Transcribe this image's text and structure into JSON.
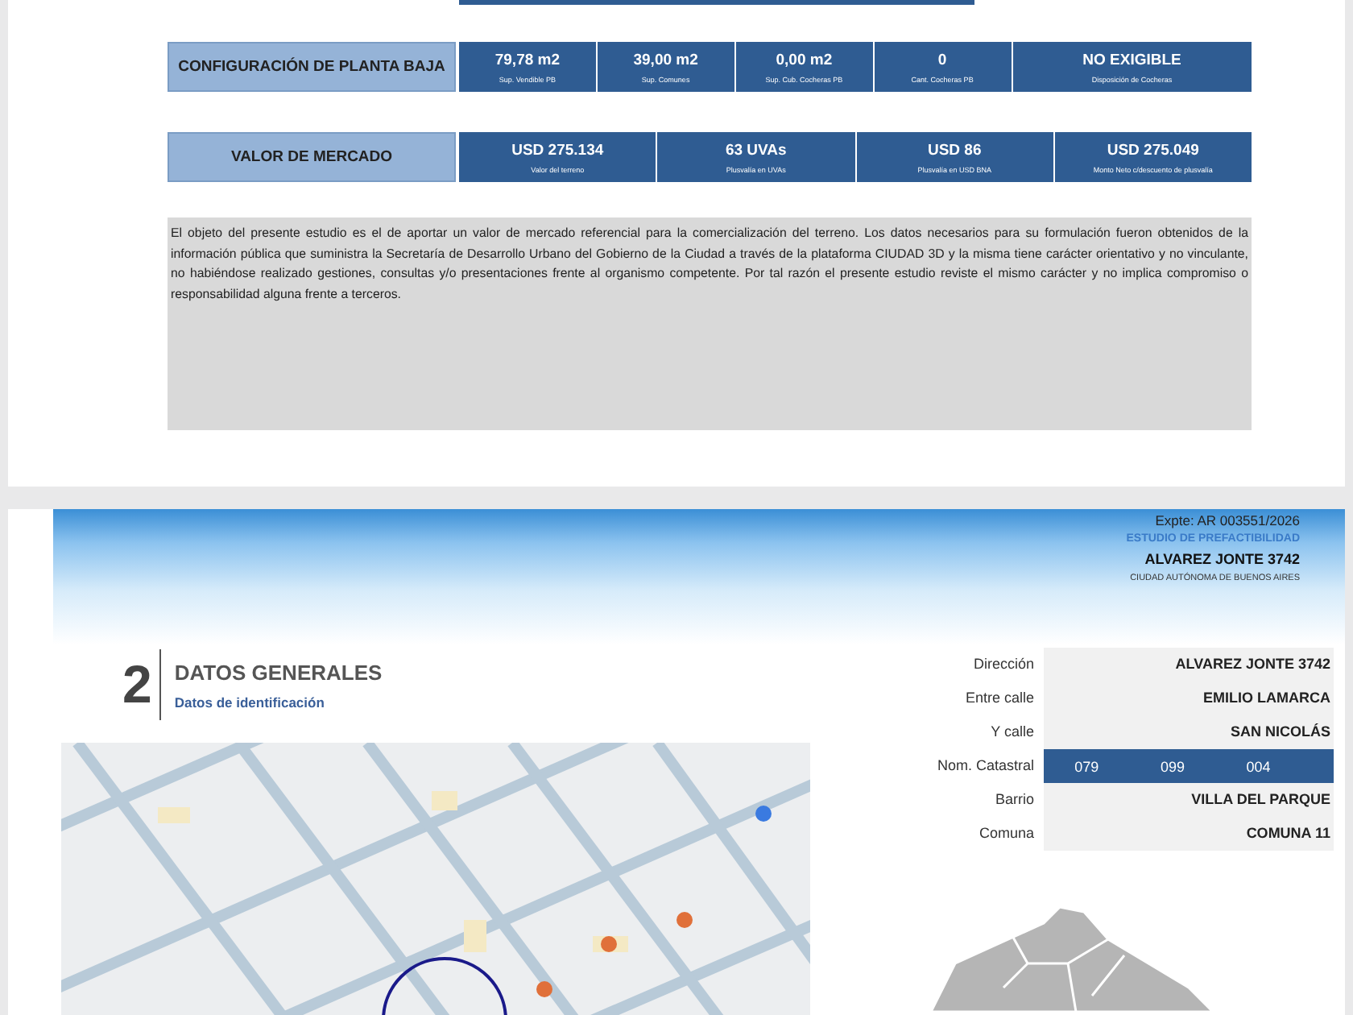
{
  "page_one": {
    "ground_floor": {
      "heading": "CONFIGURACIÓN DE PLANTA BAJA",
      "cells": [
        {
          "value": "79,78 m2",
          "caption": "Sup. Vendible PB",
          "wide": false
        },
        {
          "value": "39,00 m2",
          "caption": "Sup. Comunes",
          "wide": false
        },
        {
          "value": "0,00 m2",
          "caption": "Sup. Cub. Cocheras  PB",
          "wide": false
        },
        {
          "value": "0",
          "caption": "Cant. Cocheras PB",
          "wide": false
        },
        {
          "value": "NO EXIGIBLE",
          "caption": "Disposición de Cocheras",
          "wide": true
        }
      ]
    },
    "market_value": {
      "heading": "VALOR DE MERCADO",
      "cells": [
        {
          "value": "USD 275.134",
          "caption": "Valor del terreno"
        },
        {
          "value": "63 UVAs",
          "caption": "Plusvalía en UVAs"
        },
        {
          "value": "USD 86",
          "caption": "Plusvalía en USD  BNA"
        },
        {
          "value": "USD 275.049",
          "caption": "Monto Neto  c/descuento de plusvalía"
        }
      ]
    },
    "disclaimer": "El objeto del presente estudio es el de aportar un valor de mercado referencial para la comercialización del terreno. Los datos necesarios para su formulación fueron obtenidos de la información pública que suministra la Secretaría de Desarrollo Urbano del Gobierno de la Ciudad a través de la plataforma CIUDAD 3D y la misma tiene carácter orientativo y no vinculante, no habiéndose realizado gestiones, consultas y/o presentaciones frente al organismo competente. Por tal razón el presente estudio reviste el mismo carácter y no implica compromiso o responsabilidad alguna frente a terceros."
  },
  "page_two": {
    "header": {
      "file_number": "Expte: AR 003551/2026",
      "study_type": "ESTUDIO DE PREFACTIBILIDAD",
      "address": "ALVAREZ JONTE 3742",
      "city": "CIUDAD AUTÓNOMA DE BUENOS AIRES"
    },
    "section": {
      "number": "2",
      "title": "DATOS GENERALES",
      "subtitle": "Datos de identificación"
    },
    "details": [
      {
        "kind": "text",
        "label": "Dirección",
        "value": "ALVAREZ JONTE 3742"
      },
      {
        "kind": "text",
        "label": "Entre calle",
        "value": "EMILIO LAMARCA"
      },
      {
        "kind": "text",
        "label": "Y calle",
        "value": "SAN NICOLÁS"
      },
      {
        "kind": "cadastral",
        "label": "Nom. Catastral",
        "parts": [
          "079",
          "099",
          "004"
        ]
      },
      {
        "kind": "text",
        "label": "Barrio",
        "value": "VILLA DEL PARQUE"
      },
      {
        "kind": "text",
        "label": "Comuna",
        "value": "COMUNA 11"
      }
    ]
  }
}
